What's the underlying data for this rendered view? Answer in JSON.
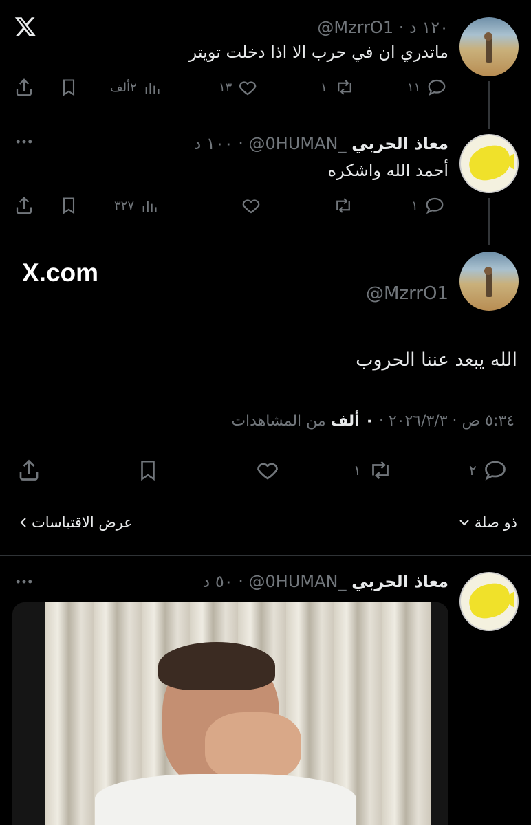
{
  "app": {
    "logo_icon": "x-logo-icon",
    "watermark": "X.com"
  },
  "tweet1": {
    "handle": "@MzrrO1",
    "time": "١٢٠ د",
    "text": "ماتدري ان في حرب الا اذا دخلت تويتر",
    "replies": "١١",
    "reposts": "١",
    "likes": "١٣",
    "views": "٢ألف"
  },
  "tweet2": {
    "display_name": "معاذ الحربي",
    "handle": "_0HUMAN@",
    "time": "١٠٠ د",
    "text": "أحمد الله واشكره",
    "replies": "١",
    "views": "٣٢٧"
  },
  "main_tweet": {
    "handle": "@MzrrO1",
    "text": "الله يبعد عننا الحروب",
    "meta_time": "٥:٣٤ ص · ٢٠٢٦/٣/٣ ·",
    "meta_views_count": "٠ ألف",
    "meta_views_label": "من المشاهدات",
    "replies": "٢",
    "reposts": "١",
    "relevance_label": "ذو صلة",
    "quotes_label": "عرض الاقتباسات"
  },
  "reply_tweet": {
    "display_name": "معاذ الحربي",
    "handle": "_0HUMAN@",
    "time": "٥٠ د"
  },
  "colors": {
    "bg": "#000000",
    "text": "#e7e9ea",
    "muted": "#71767b",
    "divider": "#2f3336"
  }
}
